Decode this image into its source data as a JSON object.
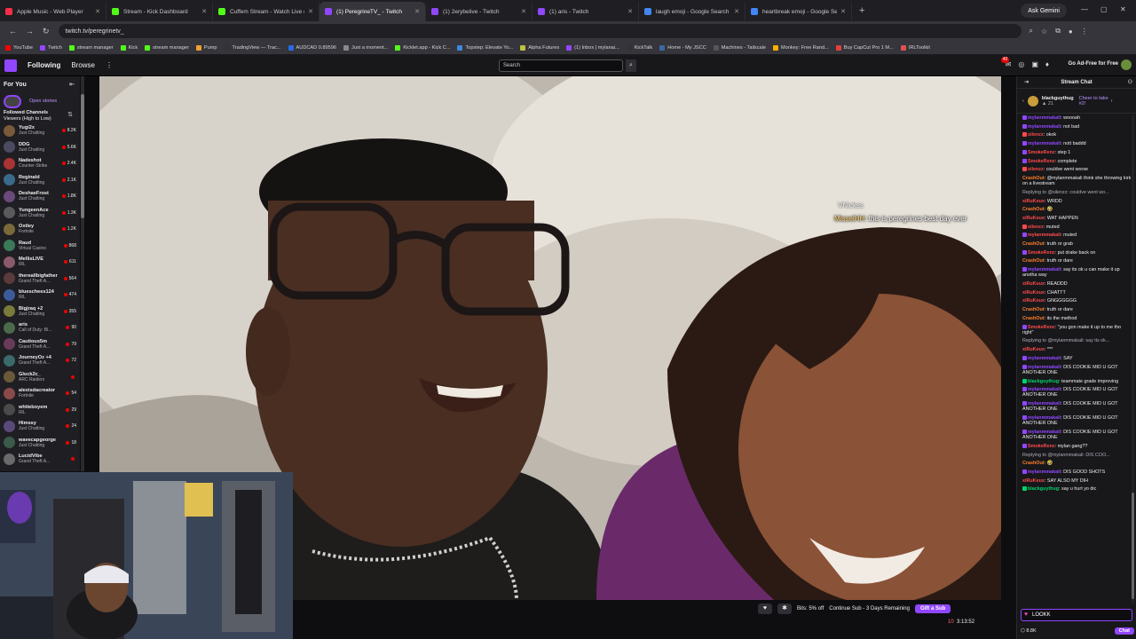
{
  "browser": {
    "tabs": [
      {
        "title": "Apple Music - Web Player",
        "color": "#fa2d48"
      },
      {
        "title": "Stream - Kick Dashboard",
        "color": "#53fc18"
      },
      {
        "title": "Cuffem Stream - Watch Live on",
        "color": "#53fc18"
      },
      {
        "title": "(1) PeregrineTV_ - Twitch",
        "color": "#9146ff"
      },
      {
        "title": "(1) 2erybelive - Twitch",
        "color": "#9146ff"
      },
      {
        "title": "(1) aris - Twitch",
        "color": "#9146ff"
      },
      {
        "title": "laugh emoji - Google Search",
        "color": "#4285f4"
      },
      {
        "title": "heartbreak emoji - Google Sea",
        "color": "#4285f4"
      }
    ],
    "new_tab": "+",
    "gemini": "Ask Gemini",
    "url": "twitch.tv/peregrinetv_",
    "bookmarks": [
      "YouTube",
      "Twitch",
      "stream manager",
      "Kick",
      "stream manager",
      "Pump",
      "TradingView — Trac...",
      "AUDCAD 0.89596",
      "Just a moment...",
      "Kicklet.app - Kick C...",
      "Topstep: Elevate Yo...",
      "Alpha Futures",
      "(1) Inbox | mylanai...",
      "KickTalk",
      "Home - My JSCC",
      "Machines - Tailscale",
      "Monkey: Free Rand...",
      "Buy CapCut Pro 1 M...",
      "IRLToolkit"
    ]
  },
  "twitch_nav": {
    "following": "Following",
    "browse": "Browse",
    "more": "⋮",
    "search_placeholder": "Search",
    "notif_count": "40",
    "ad_free": "Go Ad-Free for Free"
  },
  "sidebar": {
    "for_you": "For You",
    "collapse": "⇤",
    "open_stories": "Open stories",
    "section_title": "Followed Channels",
    "section_sub": "Viewers (High to Low)",
    "channels": [
      {
        "name": "Yugi2x",
        "game": "Just Chatting",
        "viewers": "8.2K",
        "color": "#7a5a3a"
      },
      {
        "name": "DDG",
        "game": "Just Chatting",
        "viewers": "5.6K",
        "color": "#4a4a60"
      },
      {
        "name": "Nadeshot",
        "game": "Counter-Strike",
        "viewers": "2.4K",
        "color": "#a33"
      },
      {
        "name": "Reginald",
        "game": "Just Chatting",
        "viewers": "2.1K",
        "color": "#3a6a8a"
      },
      {
        "name": "DeshaeFrost",
        "game": "Just Chatting",
        "viewers": "1.8K",
        "color": "#6a4a7a"
      },
      {
        "name": "YungeenAce",
        "game": "Just Chatting",
        "viewers": "1.3K",
        "color": "#5a5a5a"
      },
      {
        "name": "Oxtley",
        "game": "Fortnite",
        "viewers": "1.2K",
        "color": "#7a6a3a"
      },
      {
        "name": "Raud",
        "game": "Virtual Casino",
        "viewers": "868",
        "color": "#3a7a5a"
      },
      {
        "name": "MellisLIVE",
        "game": "IRL",
        "viewers": "611",
        "color": "#8a5a6a"
      },
      {
        "name": "thereallbigfather",
        "game": "Grand Theft A...",
        "viewers": "564",
        "color": "#5a3a3a"
      },
      {
        "name": "blueschees124",
        "game": "IRL",
        "viewers": "474",
        "color": "#3a5a9a"
      },
      {
        "name": "Bigjraq +2",
        "game": "Just Chatting",
        "viewers": "355",
        "color": "#7a7a3a"
      },
      {
        "name": "aris",
        "game": "Call of Duty: Bl...",
        "viewers": "90",
        "color": "#4a6a4a"
      },
      {
        "name": "Cautious5m",
        "game": "Grand Theft A...",
        "viewers": "79",
        "color": "#6a3a5a"
      },
      {
        "name": "JourneyOz +4",
        "game": "Grand Theft A...",
        "viewers": "72",
        "color": "#3a6a6a"
      },
      {
        "name": "Glock2c_",
        "game": "ARC Raiders",
        "viewers": "",
        "color": "#6a5a3a"
      },
      {
        "name": "alexisdacreator",
        "game": "Fortnite",
        "viewers": "54",
        "color": "#8a4a4a"
      },
      {
        "name": "whiteboyem",
        "game": "IRL",
        "viewers": "29",
        "color": "#4a4a4a"
      },
      {
        "name": "Himssy",
        "game": "Just Chatting",
        "viewers": "24",
        "color": "#5a4a7a"
      },
      {
        "name": "wavecapgeorge",
        "game": "Just Chatting",
        "viewers": "18",
        "color": "#3a5a4a"
      },
      {
        "name": "LucidVibe",
        "game": "Grand Theft A...",
        "viewers": "",
        "color": "#6a6a6a"
      }
    ]
  },
  "video_overlay": {
    "name": "VNickss",
    "chat_user": "MisselHH",
    "chat_text": ": this is peregrines best day ever"
  },
  "player_bar": {
    "bits": "Bits: 5% off",
    "continue_sub": "Continue Sub - 3 Days Remaining",
    "gift_sub": "Gift a Sub",
    "viewers": "10",
    "uptime": "3:13:52"
  },
  "chat": {
    "title": "Stream Chat",
    "pinned_user": "blackguythug",
    "pinned_sub": "▲ 21",
    "cheer": "Cheer to take #2!",
    "messages": [
      {
        "user": "mylanmmakali",
        "text": "woooah",
        "uc": "#9146ff",
        "bc": "#9146ff"
      },
      {
        "user": "mylanmmakali",
        "text": "not bad",
        "uc": "#9146ff",
        "bc": "#9146ff"
      },
      {
        "user": "silenzz",
        "text": "okok",
        "uc": "#ff4a4a",
        "bc": "#ff4a4a"
      },
      {
        "user": "mylanmmakali",
        "text": "nott baddd",
        "uc": "#9146ff",
        "bc": "#9146ff"
      },
      {
        "user": "SmokeRenz",
        "text": "step 1",
        "uc": "#ff4a4a",
        "bc": "#9146ff"
      },
      {
        "user": "SmokeRenz",
        "text": "complete",
        "uc": "#ff4a4a",
        "bc": "#9146ff"
      },
      {
        "user": "silenzz",
        "text": "couldve went worse",
        "uc": "#ff4a4a",
        "bc": "#ff4a4a"
      },
      {
        "user": "CrashOut",
        "text": "@mylanmmakali think she throwing kirk on a livestream",
        "uc": "#ff7f2a",
        "bc": ""
      },
      {
        "user": "",
        "text": "Replying to @silenzz: couldve went wo...",
        "uc": "",
        "bc": "",
        "reply": true
      },
      {
        "user": "xiRuKeux",
        "text": "WRDD",
        "uc": "#ff4a4a",
        "bc": ""
      },
      {
        "user": "CrashOut",
        "text": "🤣",
        "uc": "#ff7f2a",
        "bc": ""
      },
      {
        "user": "xiRuKeux",
        "text": "WAT HAPPEN",
        "uc": "#ff4a4a",
        "bc": ""
      },
      {
        "user": "silenzz",
        "text": "muted",
        "uc": "#ff4a4a",
        "bc": "#ff4a4a"
      },
      {
        "user": "mylanmmakali",
        "text": "muted",
        "uc": "#ff4a4a",
        "bc": "#9146ff"
      },
      {
        "user": "CrashOut",
        "text": "truth or grab",
        "uc": "#ff7f2a",
        "bc": ""
      },
      {
        "user": "SmokeRenz",
        "text": "put drake back on",
        "uc": "#ff4a4a",
        "bc": "#9146ff"
      },
      {
        "user": "CrashOut",
        "text": "truth or dare",
        "uc": "#ff7f2a",
        "bc": ""
      },
      {
        "user": "mylanmmakali",
        "text": "say its ok u can make it up anotha way",
        "uc": "#9146ff",
        "bc": "#9146ff"
      },
      {
        "user": "xiRuKeux",
        "text": "READDD",
        "uc": "#ff4a4a",
        "bc": ""
      },
      {
        "user": "xiRuKeux",
        "text": "CHATTT",
        "uc": "#ff4a4a",
        "bc": ""
      },
      {
        "user": "xiRuKeux",
        "text": "GNGGGGGG",
        "uc": "#ff4a4a",
        "bc": ""
      },
      {
        "user": "CrashOut",
        "text": "truth or dare",
        "uc": "#ff7f2a",
        "bc": ""
      },
      {
        "user": "CrashOut",
        "text": "its the method",
        "uc": "#ff7f2a",
        "bc": ""
      },
      {
        "user": "SmokeRenz",
        "text": "\"you gon make it up to me tho right\"",
        "uc": "#ff4a4a",
        "bc": "#9146ff"
      },
      {
        "user": "",
        "text": "Replying to @mylanmmakali: say its ok...",
        "uc": "",
        "bc": "",
        "reply": true
      },
      {
        "user": "xiRuKeux",
        "text": "***",
        "uc": "#ff4a4a",
        "bc": ""
      },
      {
        "user": "mylanmmakali",
        "text": "SAY",
        "uc": "#9146ff",
        "bc": "#9146ff"
      },
      {
        "user": "mylanmmakali",
        "text": "DIS COOKIE MID U GOT ANOTHER ONE",
        "uc": "#9146ff",
        "bc": "#9146ff"
      },
      {
        "user": "blackguythug",
        "text": "teammate grade improving",
        "uc": "#00d26a",
        "bc": "#00d26a"
      },
      {
        "user": "mylanmmakali",
        "text": "DIS COOKIE MID U GOT ANOTHER ONE",
        "uc": "#9146ff",
        "bc": "#9146ff"
      },
      {
        "user": "mylanmmakali",
        "text": "DIS COOKIE MID U GOT ANOTHER ONE",
        "uc": "#9146ff",
        "bc": "#9146ff"
      },
      {
        "user": "mylanmmakali",
        "text": "DIS COOKIE MID U GOT ANOTHER ONE",
        "uc": "#9146ff",
        "bc": "#9146ff"
      },
      {
        "user": "mylanmmakali",
        "text": "DIS COOKIE MID U GOT ANOTHER ONE",
        "uc": "#9146ff",
        "bc": "#9146ff"
      },
      {
        "user": "SmokeRenz",
        "text": "mylan gang??",
        "uc": "#ff4a4a",
        "bc": "#9146ff"
      },
      {
        "user": "",
        "text": "Replying to @mylanmmakali: DIS COO...",
        "uc": "",
        "bc": "",
        "reply": true
      },
      {
        "user": "CrashOut",
        "text": "🤣",
        "uc": "#ff7f2a",
        "bc": ""
      },
      {
        "user": "mylanmmakali",
        "text": "DIS GOOD SHOTS",
        "uc": "#9146ff",
        "bc": "#9146ff"
      },
      {
        "user": "xiRuKeux",
        "text": "SAY ALSO MY DIH",
        "uc": "#ff4a4a",
        "bc": ""
      },
      {
        "user": "blackguythug",
        "text": "say u hurt yo dic",
        "uc": "#00d26a",
        "bc": "#00d26a"
      }
    ],
    "input_value": "LOOKK",
    "points": "8.8K",
    "chat_button": "Chat"
  }
}
